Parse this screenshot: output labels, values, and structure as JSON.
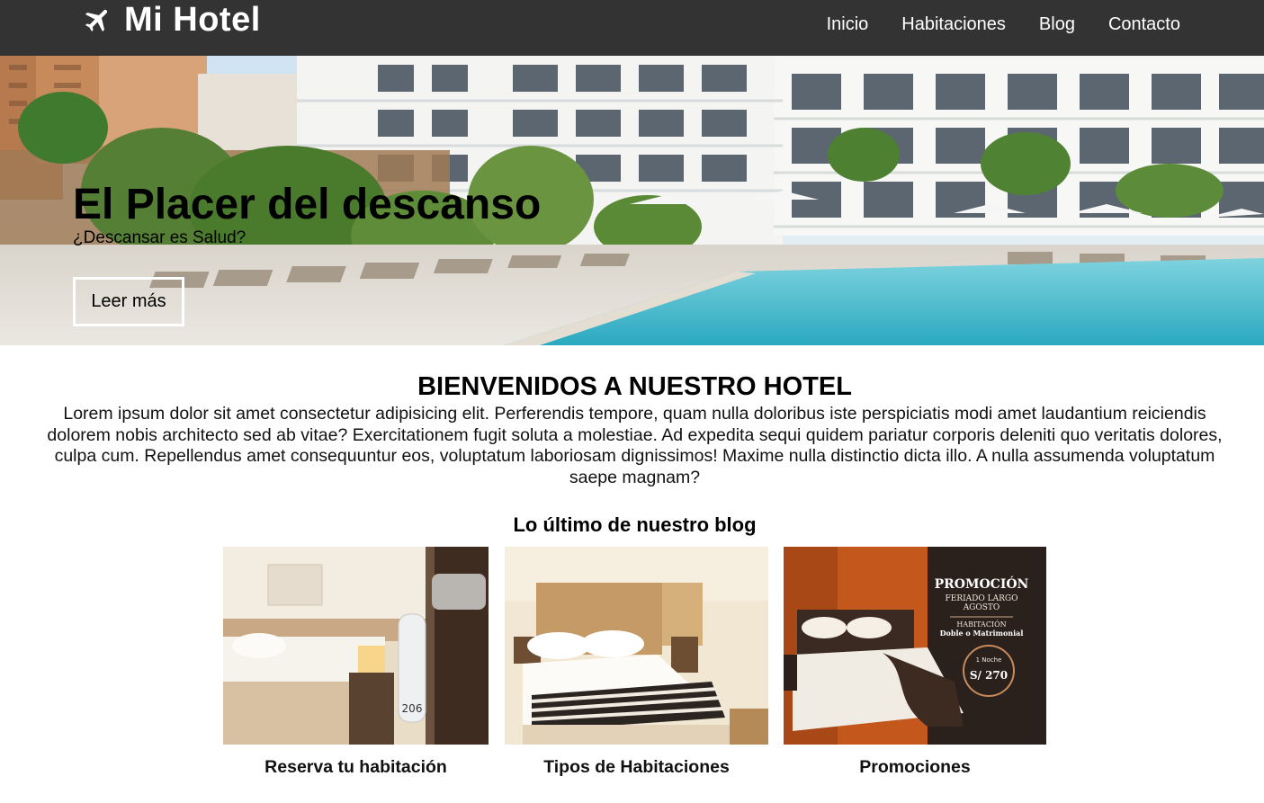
{
  "header": {
    "brand": "Mi Hotel",
    "brand_icon": "plane-icon",
    "nav": [
      "Inicio",
      "Habitaciones",
      "Blog",
      "Contacto"
    ]
  },
  "hero": {
    "title": "El Placer del descanso",
    "subtitle": "¿Descansar es Salud?",
    "button": "Leer más"
  },
  "welcome": {
    "title": "BIENVENIDOS A NUESTRO HOTEL",
    "text": "Lorem ipsum dolor sit amet consectetur adipisicing elit. Perferendis tempore, quam nulla doloribus iste perspiciatis modi amet laudantium reiciendis dolorem nobis architecto sed ab vitae? Exercitationem fugit soluta a molestiae. Ad expedita sequi quidem pariatur corporis deleniti quo veritatis dolores, culpa cum. Repellendus amet consequuntur eos, voluptatum laboriosam dignissimos! Maxime nulla distinctio dicta illo. A nulla assumenda voluptatum saepe magnam?"
  },
  "blog": {
    "title": "Lo último de nuestro blog",
    "posts": [
      {
        "caption": "Reserva tu habitación",
        "tag_number": "206"
      },
      {
        "caption": "Tipos de Habitaciones"
      },
      {
        "caption": "Promociones",
        "promo": {
          "title": "PROMOCIÓN",
          "line1": "FERIADO LARGO",
          "line2": "AGOSTO",
          "line3": "HABITACIÓN",
          "line4": "Doble o Matrimonial",
          "price_label": "1 Noche",
          "price": "S/ 270"
        }
      }
    ]
  },
  "colors": {
    "header_bg": "#333333",
    "pool": "#2fb3c9"
  }
}
